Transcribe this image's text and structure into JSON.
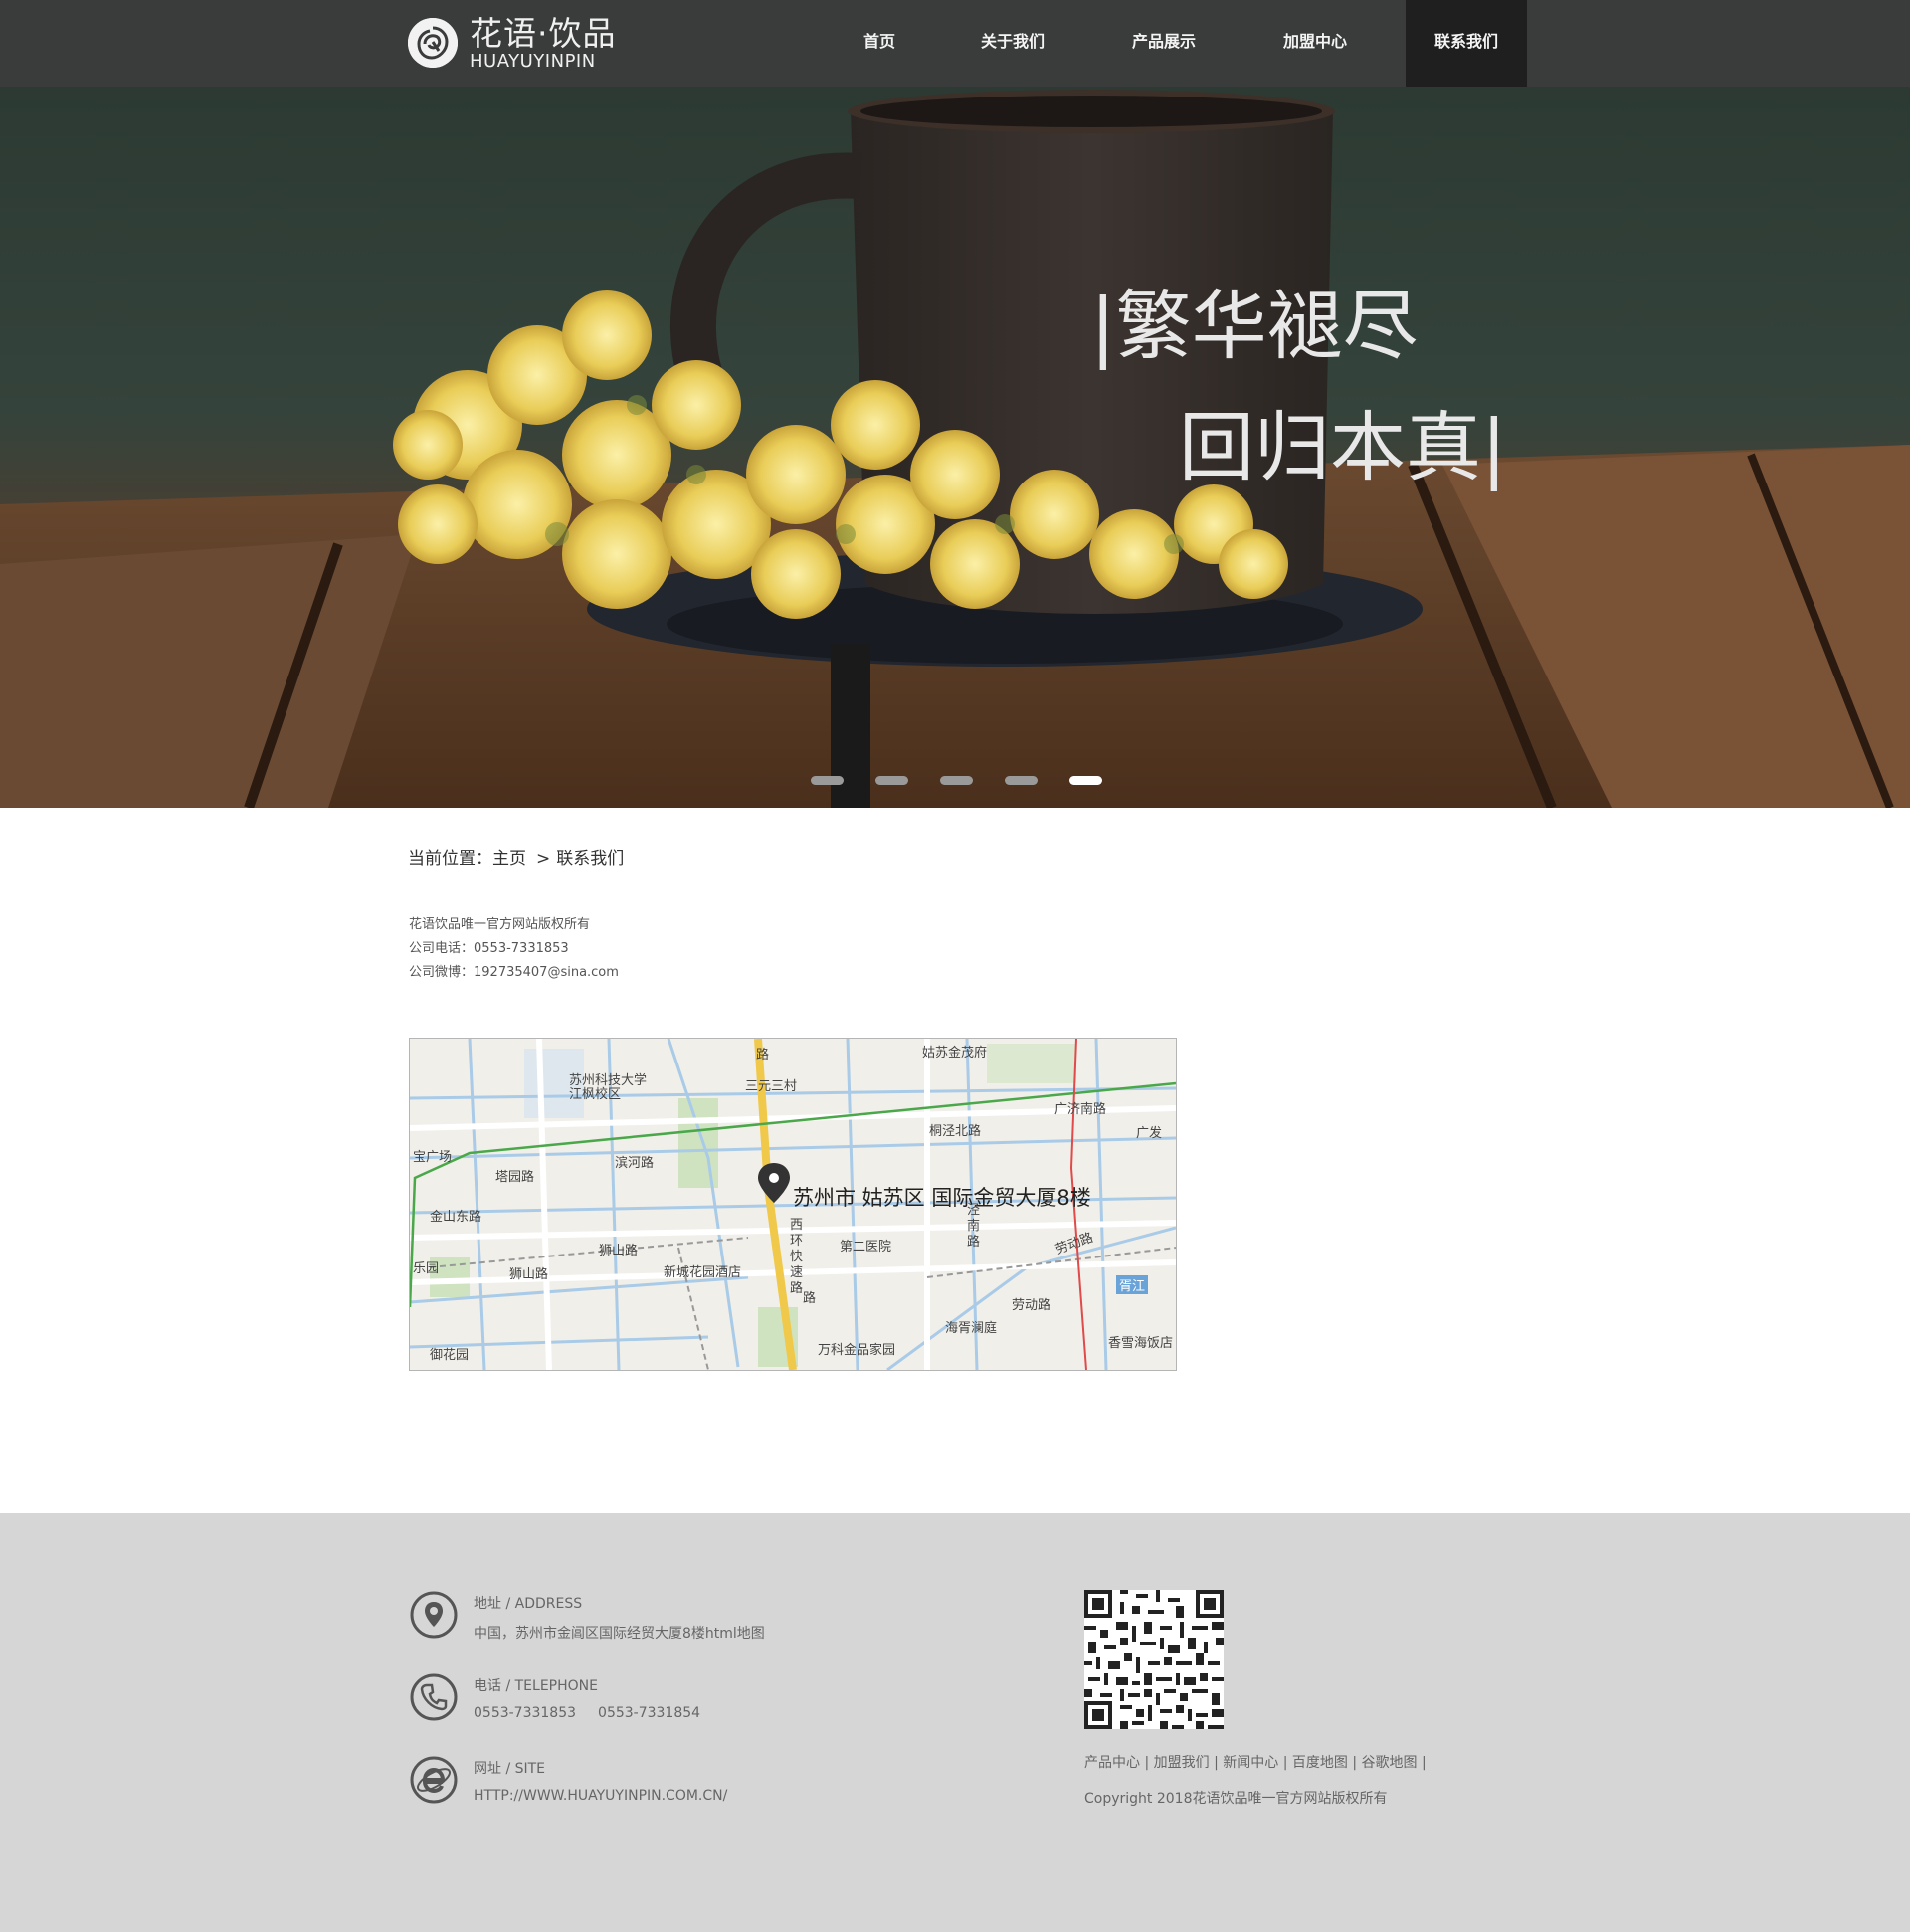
{
  "header": {
    "logo_cn": "花语·饮品",
    "logo_en": "HUAYUYINPIN",
    "nav": [
      {
        "label": "首页"
      },
      {
        "label": "关于我们"
      },
      {
        "label": "产品展示"
      },
      {
        "label": "加盟中心"
      },
      {
        "label": "联系我们",
        "active": true
      }
    ]
  },
  "banner": {
    "line1": "|繁华褪尽",
    "line2": "回归本真|",
    "slides": 5,
    "active_slide": 5
  },
  "breadcrumb": {
    "prefix": "当前位置：",
    "home": "主页",
    "sep": ">",
    "current": "联系我们"
  },
  "info": {
    "line1": "花语饮品唯一官方网站版权所有",
    "line2": "公司电话：0553-7331853",
    "line3": "公司微博：192735407@sina.com"
  },
  "map": {
    "address": "苏州市 姑苏区 国际金贸大厦8楼",
    "labels": [
      "姑苏金茂府",
      "苏州科技大学江枫校区",
      "三元三村",
      "广济南路",
      "桐泾北路",
      "广发",
      "宝广场",
      "塔园路",
      "滨河路",
      "金山东路",
      "狮山路",
      "狮山路",
      "新城花园酒店",
      "第二医院",
      "乐园",
      "西环快速路",
      "泾南路",
      "劳动路",
      "胥江",
      "劳动路",
      "海胥澜庭",
      "御花园",
      "万科金品家园",
      "香雪海饭店",
      "路",
      "路"
    ]
  },
  "footer": {
    "address_title": "地址 / ADDRESS",
    "address_text": "中国，苏州市金阊区国际经贸大厦8楼html地图",
    "phone_title": "电话 / TELEPHONE",
    "phone1": "0553-7331853",
    "phone2": "0553-7331854",
    "site_title": "网址 / SITE",
    "site_text": "HTTP://WWW.HUAYUYINPIN.COM.CN/",
    "links": [
      "产品中心",
      "加盟我们",
      "新闻中心",
      "百度地图",
      "谷歌地图"
    ],
    "copyright": "Copyright 2018花语饮品唯一官方网站版权所有"
  }
}
